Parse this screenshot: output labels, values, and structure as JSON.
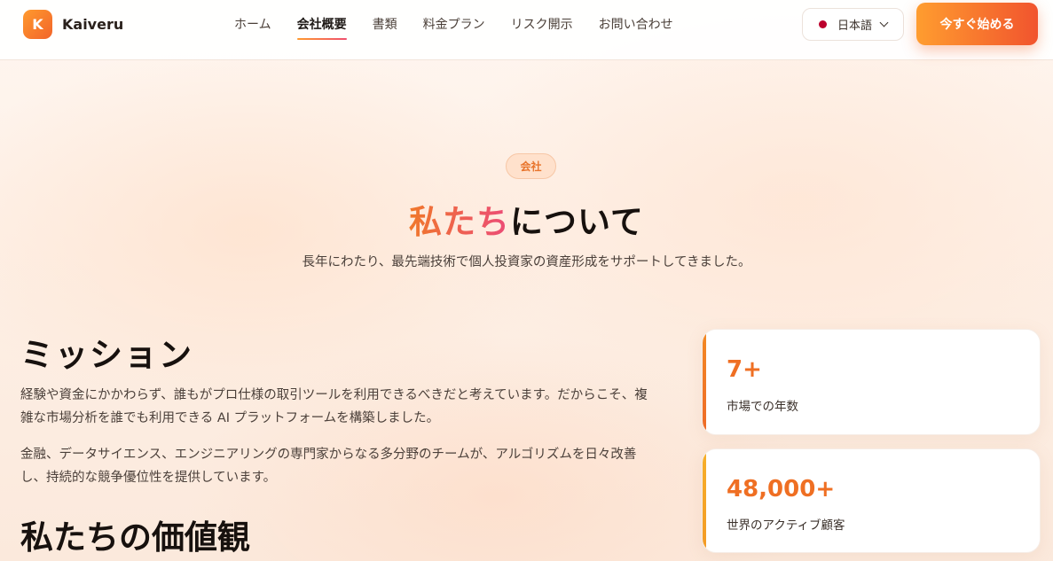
{
  "brand": {
    "logo_letter": "K",
    "name": "Kaiveru"
  },
  "nav": {
    "items": [
      {
        "label": "ホーム"
      },
      {
        "label": "会社概要",
        "active": true
      },
      {
        "label": "書類"
      },
      {
        "label": "料金プラン"
      },
      {
        "label": "リスク開示"
      },
      {
        "label": "お問い合わせ"
      }
    ]
  },
  "language": {
    "label": "日本語",
    "flag_icon": "japan-flag-icon"
  },
  "cta": {
    "label": "今すぐ始める"
  },
  "hero": {
    "badge": "会社",
    "title_accent": "私たち",
    "title_rest": "について",
    "subtitle": "長年にわたり、最先端技術で個人投資家の資産形成をサポートしてきました。"
  },
  "mission": {
    "heading": "ミッション",
    "paragraph1": "経験や資金にかかわらず、誰もがプロ仕様の取引ツールを利用できるべきだと考えています。だからこそ、複雑な市場分析を誰でも利用できる AI プラットフォームを構築しました。",
    "paragraph2": "金融、データサイエンス、エンジニアリングの専門家からなる多分野のチームが、アルゴリズムを日々改善し、持続的な競争優位性を提供しています。"
  },
  "values": {
    "heading": "私たちの価値観"
  },
  "stats": [
    {
      "value": "7+",
      "label": "市場での年数"
    },
    {
      "value": "48,000+",
      "label": "世界のアクティブ顧客"
    }
  ],
  "colors": {
    "accent": "#ef6f23",
    "cta_start": "#ff9d2f",
    "cta_end": "#f1542e"
  }
}
